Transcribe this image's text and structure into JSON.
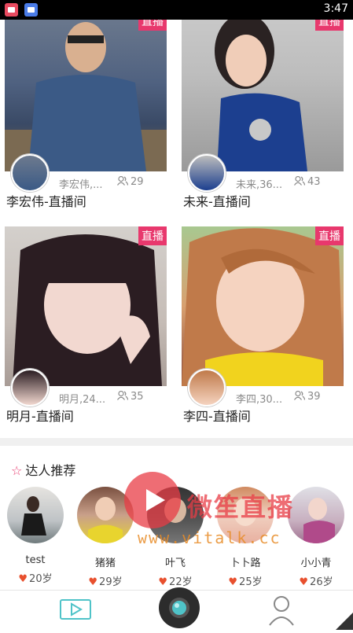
{
  "status_bar": {
    "time": "3:47"
  },
  "live_cards": [
    {
      "badge": "直播",
      "anchor": "李宏伟,...",
      "viewers": "29",
      "title": "李宏伟-直播间"
    },
    {
      "badge": "直播",
      "anchor": "未来,36...",
      "viewers": "43",
      "title": "未来-直播间"
    },
    {
      "badge": "直播",
      "anchor": "明月,24...",
      "viewers": "35",
      "title": "明月-直播间"
    },
    {
      "badge": "直播",
      "anchor": "李四,30...",
      "viewers": "39",
      "title": "李四-直播间"
    }
  ],
  "talent_section": {
    "title": "达人推荐",
    "items": [
      {
        "name": "test",
        "age": "20岁"
      },
      {
        "name": "猪猪",
        "age": "29岁"
      },
      {
        "name": "叶飞",
        "age": "22岁"
      },
      {
        "name": "卜卜路",
        "age": "25岁"
      },
      {
        "name": "小小青",
        "age": "26岁"
      }
    ]
  },
  "watermark": {
    "brand": "微笙直播",
    "url": "www.vitalk.cc"
  },
  "colors": {
    "accent": "#e8386d",
    "tab_active": "#4fc3c8",
    "heart": "#e8502e"
  },
  "icons": [
    "video-tab-icon",
    "camera-tab-icon",
    "profile-tab-icon",
    "star-icon",
    "heart-icon",
    "user-icon"
  ]
}
